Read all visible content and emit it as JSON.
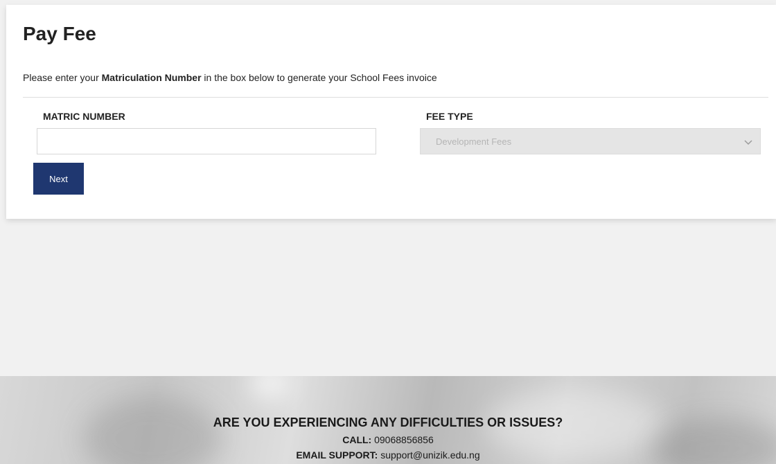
{
  "card": {
    "title": "Pay Fee",
    "instructions": {
      "prefix": "Please enter your ",
      "emphasis": "Matriculation Number",
      "suffix": " in the box below to generate your School Fees invoice"
    },
    "matric": {
      "label": "MATRIC NUMBER",
      "value": "",
      "placeholder": ""
    },
    "fee_type": {
      "label": "FEE TYPE",
      "selected": "Development Fees",
      "icon": "chevron-down-icon"
    },
    "next_label": "Next"
  },
  "footer": {
    "heading": "ARE YOU EXPERIENCING ANY DIFFICULTIES OR ISSUES?",
    "call_label": "CALL:",
    "call_value": "09068856856",
    "email_label": "EMAIL SUPPORT:",
    "email_value": "support@unizik.edu.ng"
  },
  "colors": {
    "page_background": "#f1f1f1",
    "card_background": "#ffffff",
    "button_background": "#1f3770",
    "select_background": "#e5e5e5"
  }
}
